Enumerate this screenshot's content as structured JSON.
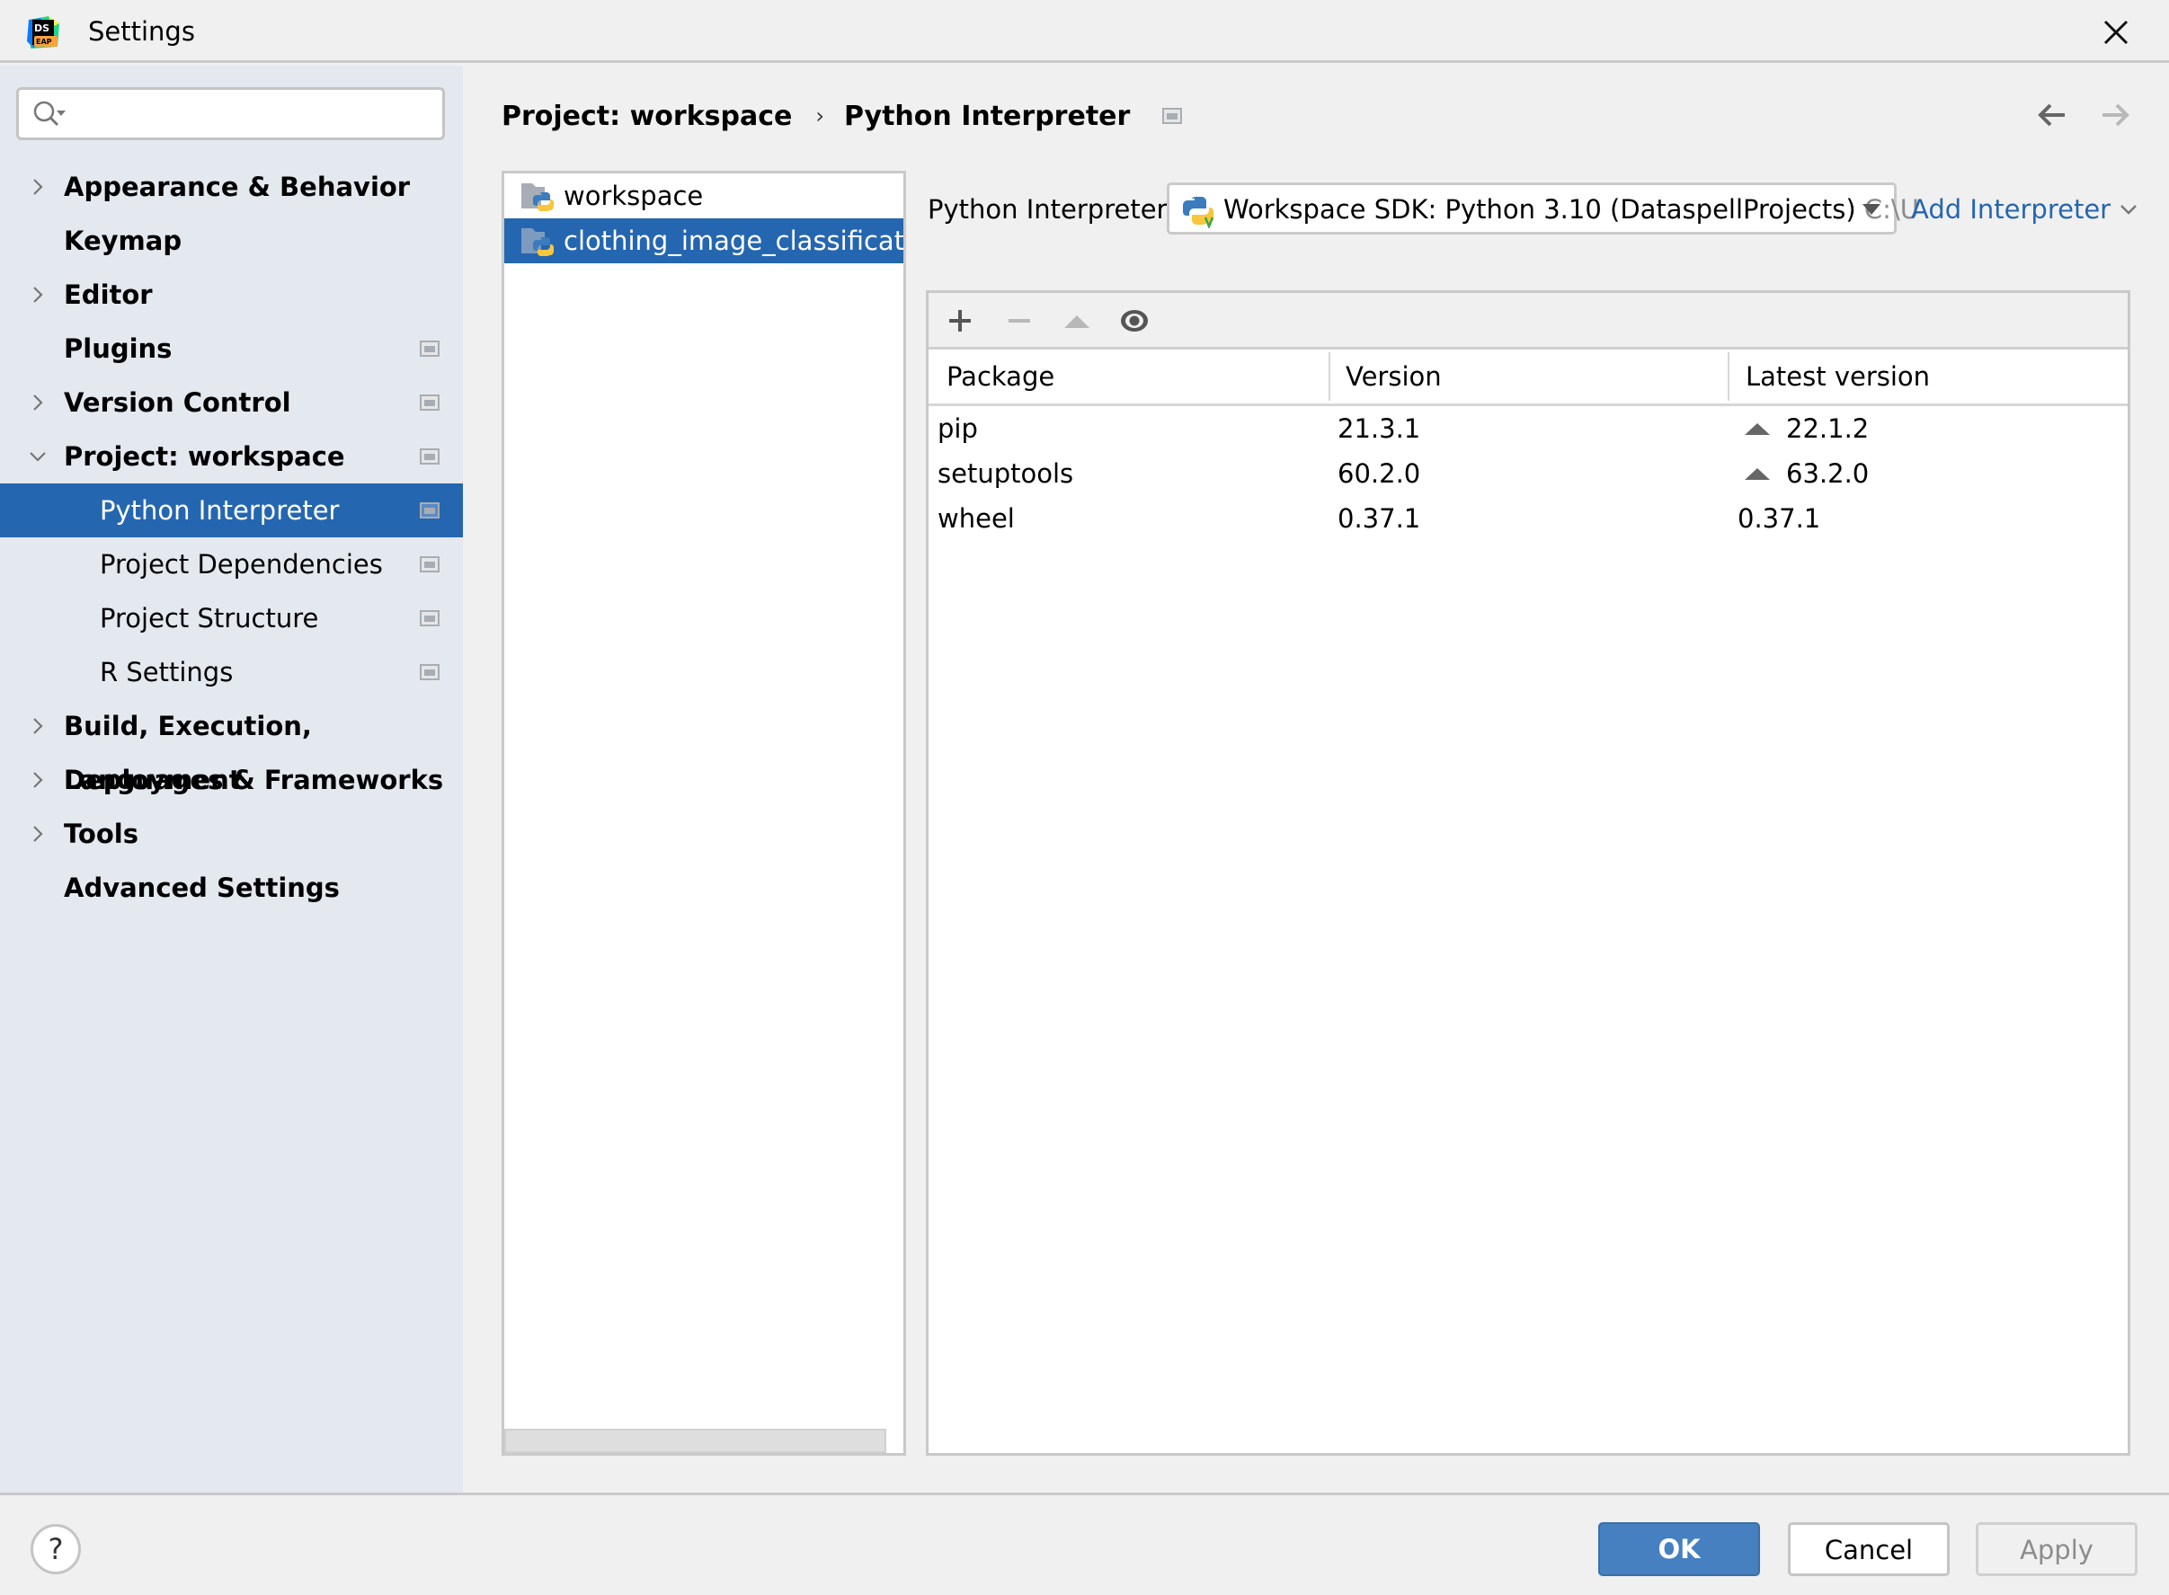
{
  "window": {
    "title": "Settings",
    "logo_text_top": "DS",
    "logo_text_bottom": "EAP"
  },
  "search": {
    "value": "",
    "placeholder": ""
  },
  "sidebar": {
    "items": [
      {
        "label": "Appearance & Behavior",
        "expandable": true,
        "expanded": false,
        "bold": true,
        "project_icon": false
      },
      {
        "label": "Keymap",
        "expandable": false,
        "bold": true,
        "project_icon": false
      },
      {
        "label": "Editor",
        "expandable": true,
        "expanded": false,
        "bold": true,
        "project_icon": false
      },
      {
        "label": "Plugins",
        "expandable": false,
        "bold": true,
        "project_icon": true
      },
      {
        "label": "Version Control",
        "expandable": true,
        "expanded": false,
        "bold": true,
        "project_icon": true
      },
      {
        "label": "Project: workspace",
        "expandable": true,
        "expanded": true,
        "bold": true,
        "project_icon": true
      },
      {
        "label": "Python Interpreter",
        "child": true,
        "selected": true,
        "project_icon": true
      },
      {
        "label": "Project Dependencies",
        "child": true,
        "project_icon": true
      },
      {
        "label": "Project Structure",
        "child": true,
        "project_icon": true
      },
      {
        "label": "R Settings",
        "child": true,
        "project_icon": true
      },
      {
        "label": "Build, Execution, Deployment",
        "expandable": true,
        "expanded": false,
        "bold": true,
        "project_icon": false
      },
      {
        "label": "Languages & Frameworks",
        "expandable": true,
        "expanded": false,
        "bold": true,
        "project_icon": false
      },
      {
        "label": "Tools",
        "expandable": true,
        "expanded": false,
        "bold": true,
        "project_icon": false
      },
      {
        "label": "Advanced Settings",
        "expandable": false,
        "bold": true,
        "project_icon": false
      }
    ]
  },
  "breadcrumb": {
    "parent": "Project: workspace",
    "separator": "›",
    "current": "Python Interpreter"
  },
  "projects": [
    {
      "name": "workspace",
      "selected": false
    },
    {
      "name": "clothing_image_classification",
      "selected": true
    }
  ],
  "interpreter": {
    "label": "Python Interpreter:",
    "selected_name": "Workspace SDK: Python 3.10 (DataspellProjects)",
    "selected_path": "C:\\U",
    "add_label": "Add Interpreter"
  },
  "packages": {
    "toolbar": [
      "add-icon",
      "remove-icon",
      "upgrade-icon",
      "eye-icon"
    ],
    "columns": [
      "Package",
      "Version",
      "Latest version"
    ],
    "rows": [
      {
        "package": "pip",
        "version": "21.3.1",
        "latest": "22.1.2",
        "upgrade_available": true
      },
      {
        "package": "setuptools",
        "version": "60.2.0",
        "latest": "63.2.0",
        "upgrade_available": true
      },
      {
        "package": "wheel",
        "version": "0.37.1",
        "latest": "0.37.1",
        "upgrade_available": false
      }
    ]
  },
  "footer": {
    "help_label": "?",
    "ok_label": "OK",
    "cancel_label": "Cancel",
    "apply_label": "Apply"
  },
  "colors": {
    "accent": "#2566b0",
    "ok_button": "#4680c0",
    "sidebar_bg": "#e4e8ef"
  }
}
